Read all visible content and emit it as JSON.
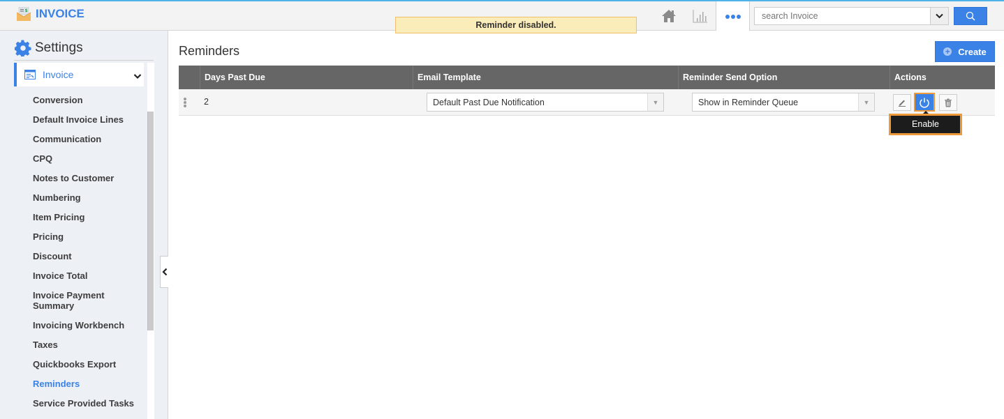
{
  "app": {
    "title": "INVOICE",
    "accent_color": "#3b82e6"
  },
  "topbar": {
    "icons": [
      "home-icon",
      "chart-icon",
      "more-icon"
    ],
    "search": {
      "placeholder": "search Invoice",
      "value": ""
    }
  },
  "toast": {
    "message": "Reminder disabled."
  },
  "sidebar": {
    "title": "Settings",
    "section": "Invoice",
    "items": [
      {
        "label": "Conversion",
        "active": false
      },
      {
        "label": "Default Invoice Lines",
        "active": false
      },
      {
        "label": "Communication",
        "active": false
      },
      {
        "label": "CPQ",
        "active": false
      },
      {
        "label": "Notes to Customer",
        "active": false
      },
      {
        "label": "Numbering",
        "active": false
      },
      {
        "label": "Item Pricing",
        "active": false
      },
      {
        "label": "Pricing",
        "active": false
      },
      {
        "label": "Discount",
        "active": false
      },
      {
        "label": "Invoice Total",
        "active": false
      },
      {
        "label": "Invoice Payment Summary",
        "active": false
      },
      {
        "label": "Invoicing Workbench",
        "active": false
      },
      {
        "label": "Taxes",
        "active": false
      },
      {
        "label": "Quickbooks Export",
        "active": false
      },
      {
        "label": "Reminders",
        "active": true
      },
      {
        "label": "Service Provided Tasks",
        "active": false
      }
    ]
  },
  "main": {
    "title": "Reminders",
    "create_label": "Create",
    "table": {
      "columns": [
        "",
        "Days Past Due",
        "Email Template",
        "Reminder Send Option",
        "Actions"
      ],
      "rows": [
        {
          "days_past_due": "2",
          "email_template": "Default Past Due Notification",
          "send_option": "Show in Reminder Queue"
        }
      ]
    },
    "tooltip": "Enable"
  }
}
